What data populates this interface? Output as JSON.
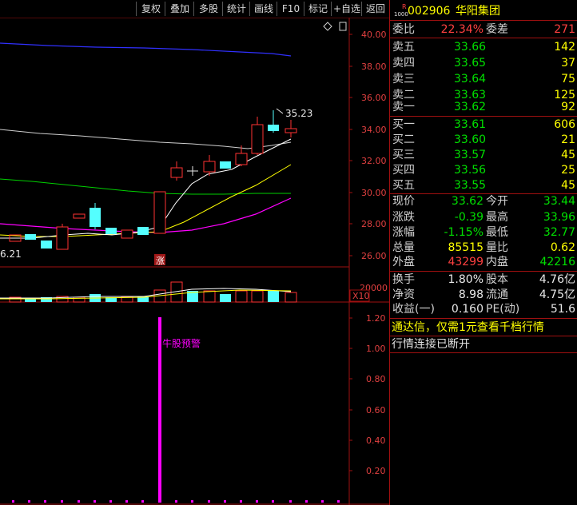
{
  "toolbar": {
    "buttons": [
      "复权",
      "叠加",
      "多股",
      "统计",
      "画线",
      "F10",
      "标记",
      "+自选",
      "返回"
    ]
  },
  "stock": {
    "badge_top": "R",
    "badge_bottom": "1000",
    "code": "002906",
    "name": "华阳集团"
  },
  "weibi": {
    "label": "委比",
    "value": "22.34%",
    "label2": "委差",
    "value2": "271"
  },
  "sells": [
    {
      "label": "卖五",
      "price": "33.66",
      "vol": "142"
    },
    {
      "label": "卖四",
      "price": "33.65",
      "vol": "37"
    },
    {
      "label": "卖三",
      "price": "33.64",
      "vol": "75"
    },
    {
      "label": "卖二",
      "price": "33.63",
      "vol": "125"
    },
    {
      "label": "卖一",
      "price": "33.62",
      "vol": "92"
    }
  ],
  "buys": [
    {
      "label": "买一",
      "price": "33.61",
      "vol": "606"
    },
    {
      "label": "买二",
      "price": "33.60",
      "vol": "21"
    },
    {
      "label": "买三",
      "price": "33.57",
      "vol": "45"
    },
    {
      "label": "买四",
      "price": "33.56",
      "vol": "25"
    },
    {
      "label": "买五",
      "price": "33.55",
      "vol": "45"
    }
  ],
  "quote": [
    {
      "l1": "现价",
      "v1": "33.62",
      "l2": "今开",
      "v2": "33.44"
    },
    {
      "l1": "涨跌",
      "v1": "-0.39",
      "l2": "最高",
      "v2": "33.96"
    },
    {
      "l1": "涨幅",
      "v1": "-1.15%",
      "l2": "最低",
      "v2": "32.77"
    },
    {
      "l1": "总量",
      "v1": "85515",
      "l2": "量比",
      "v2": "0.62"
    },
    {
      "l1": "外盘",
      "v1": "43299",
      "l2": "内盘",
      "v2": "42216"
    }
  ],
  "finance": [
    {
      "l1": "换手",
      "v1": "1.80%",
      "l2": "股本",
      "v2": "4.76亿"
    },
    {
      "l1": "净资",
      "v1": "8.98",
      "l2": "流通",
      "v2": "4.75亿"
    },
    {
      "l1": "收益(一)",
      "v1": "0.160",
      "l2": "PE(动)",
      "v2": "51.6"
    }
  ],
  "notice": "通达信，仅需1元查看千档行情",
  "status": "行情连接已断开",
  "chart": {
    "price_axis": [
      "40.00",
      "38.00",
      "36.00",
      "34.00",
      "32.00",
      "30.00",
      "28.00",
      "26.00"
    ],
    "high_label": "35.23",
    "low_label": "6.21",
    "zhang_label": "涨",
    "volume_axis_label": "20000",
    "volume_unit": "X10",
    "indicator_axis": [
      "1.20",
      "1.00",
      "0.80",
      "0.60",
      "0.40",
      "0.20"
    ],
    "signal_label": "牛股预警",
    "colors": {
      "up": "#ff3232",
      "down": "#54ffff",
      "ma5": "#ffffff",
      "ma10": "#ffff00",
      "ma20": "#ff00ff",
      "ma60": "#00ff00",
      "ma120": "#3030ff",
      "signal": "#ff00ff"
    }
  }
}
